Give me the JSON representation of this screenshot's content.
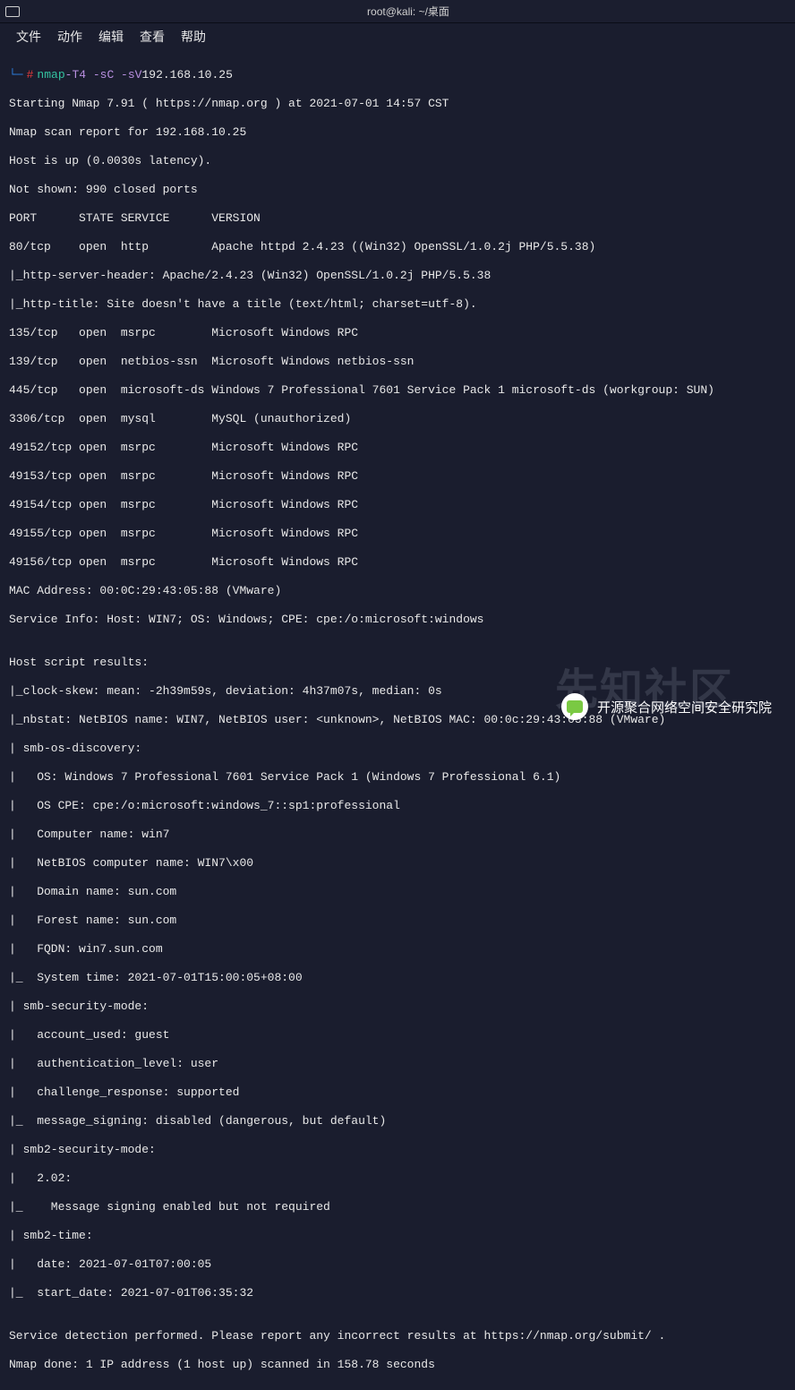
{
  "titlebar": {
    "title": "root@kali: ~/桌面"
  },
  "menubar": {
    "items": [
      "文件",
      "动作",
      "编辑",
      "查看",
      "帮助"
    ]
  },
  "prompt": {
    "lbracket": "└─",
    "hash": "#",
    "cmd": "nmap",
    "flags": "-T4 -sC -sV",
    "target": "192.168.10.25"
  },
  "output": {
    "l0": "Starting Nmap 7.91 ( https://nmap.org ) at 2021-07-01 14:57 CST",
    "l1": "Nmap scan report for 192.168.10.25",
    "l2": "Host is up (0.0030s latency).",
    "l3": "Not shown: 990 closed ports",
    "l4": "PORT      STATE SERVICE      VERSION",
    "l5": "80/tcp    open  http         Apache httpd 2.4.23 ((Win32) OpenSSL/1.0.2j PHP/5.5.38)",
    "l6": "|_http-server-header: Apache/2.4.23 (Win32) OpenSSL/1.0.2j PHP/5.5.38",
    "l7": "|_http-title: Site doesn't have a title (text/html; charset=utf-8).",
    "l8": "135/tcp   open  msrpc        Microsoft Windows RPC",
    "l9": "139/tcp   open  netbios-ssn  Microsoft Windows netbios-ssn",
    "l10": "445/tcp   open  microsoft-ds Windows 7 Professional 7601 Service Pack 1 microsoft-ds (workgroup: SUN)",
    "l11": "3306/tcp  open  mysql        MySQL (unauthorized)",
    "l12": "49152/tcp open  msrpc        Microsoft Windows RPC",
    "l13": "49153/tcp open  msrpc        Microsoft Windows RPC",
    "l14": "49154/tcp open  msrpc        Microsoft Windows RPC",
    "l15": "49155/tcp open  msrpc        Microsoft Windows RPC",
    "l16": "49156/tcp open  msrpc        Microsoft Windows RPC",
    "l17": "MAC Address: 00:0C:29:43:05:88 (VMware)",
    "l18": "Service Info: Host: WIN7; OS: Windows; CPE: cpe:/o:microsoft:windows",
    "l19": "",
    "l20": "Host script results:",
    "l21": "|_clock-skew: mean: -2h39m59s, deviation: 4h37m07s, median: 0s",
    "l22": "|_nbstat: NetBIOS name: WIN7, NetBIOS user: <unknown>, NetBIOS MAC: 00:0c:29:43:05:88 (VMware)",
    "l23": "| smb-os-discovery:",
    "l24": "|   OS: Windows 7 Professional 7601 Service Pack 1 (Windows 7 Professional 6.1)",
    "l25": "|   OS CPE: cpe:/o:microsoft:windows_7::sp1:professional",
    "l26": "|   Computer name: win7",
    "l27": "|   NetBIOS computer name: WIN7\\x00",
    "l28": "|   Domain name: sun.com",
    "l29": "|   Forest name: sun.com",
    "l30": "|   FQDN: win7.sun.com",
    "l31": "|_  System time: 2021-07-01T15:00:05+08:00",
    "l32": "| smb-security-mode:",
    "l33": "|   account_used: guest",
    "l34": "|   authentication_level: user",
    "l35": "|   challenge_response: supported",
    "l36": "|_  message_signing: disabled (dangerous, but default)",
    "l37": "| smb2-security-mode:",
    "l38": "|   2.02:",
    "l39": "|_    Message signing enabled but not required",
    "l40": "| smb2-time:",
    "l41": "|   date: 2021-07-01T07:00:05",
    "l42": "|_  start_date: 2021-07-01T06:35:32",
    "l43": "",
    "l44": "Service detection performed. Please report any incorrect results at https://nmap.org/submit/ .",
    "l45": "Nmap done: 1 IP address (1 host up) scanned in 158.78 seconds"
  },
  "watermark": {
    "bg_text": "先知社区",
    "label": "开源聚合网络空间安全研究院"
  }
}
